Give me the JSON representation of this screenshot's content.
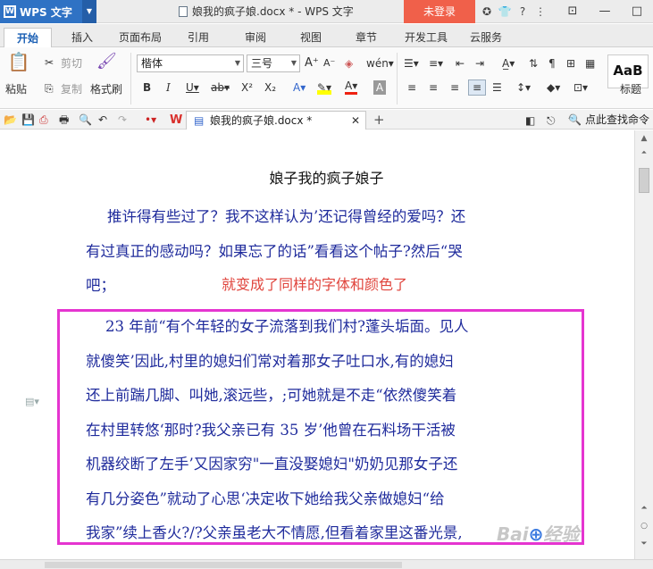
{
  "titlebar": {
    "app_name": "WPS 文字",
    "doc_title": "娘我的疯子娘.docx * - WPS 文字",
    "login": "未登录"
  },
  "tabs": [
    "开始",
    "插入",
    "页面布局",
    "引用",
    "审阅",
    "视图",
    "章节",
    "开发工具",
    "云服务"
  ],
  "ribbon": {
    "paste": "粘贴",
    "cut": "剪切",
    "copy": "复制",
    "format_painter": "格式刷",
    "font_name": "楷体",
    "font_size": "三号",
    "style_preview": "AaB",
    "style_label": "标题"
  },
  "quickbar": {
    "doc_tab": "娘我的疯子娘.docx *",
    "search": "点此查找命令"
  },
  "document": {
    "title": "娘子我的疯子娘子",
    "p1_line1": "推许得有些过了？我不这样认为’还记得曾经的爱吗？还",
    "p1_line2": "有过真正的感动吗？如果忘了的话”看看这个帖子?然后“哭",
    "p1_line3": "吧；",
    "annotation": "就变成了同样的字体和颜色了",
    "p2_line1": "23 年前“有个年轻的女子流落到我们村?蓬头垢面。见人",
    "p2_line2": "就傻笑’因此,村里的媳妇们常对着那女子吐口水,有的媳妇",
    "p2_line3": "还上前踹几脚、叫她,滚远些，;可她就是不走“依然傻笑着",
    "p2_line4": "在村里转悠‘那时?我父亲已有 35 岁’他曾在石料场干活被",
    "p2_line5": "机器绞断了左手’又因家穷\"一直没娶媳妇\"奶奶见那女子还",
    "p2_line6": "有几分姿色”就动了心思‘决定收下她给我父亲做媳妇“给",
    "p2_line7": "我家”续上香火?/?父亲虽老大不情愿,但看着家里这番光景,"
  },
  "watermark": "Baidu经验"
}
